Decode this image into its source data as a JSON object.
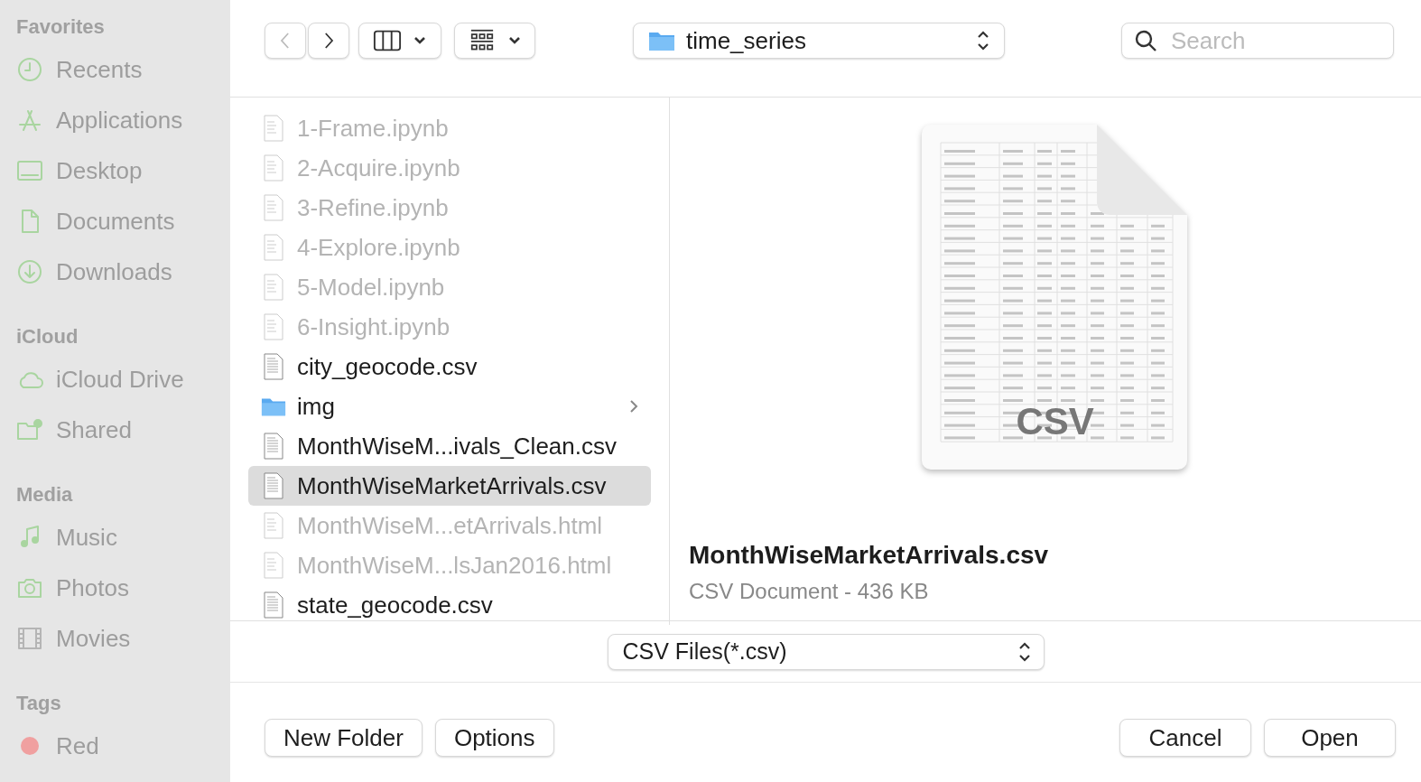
{
  "sidebar": {
    "sections": [
      {
        "title": "Favorites",
        "items": [
          {
            "label": "Recents",
            "kind": "clock",
            "disabled": true
          },
          {
            "label": "Applications",
            "kind": "apps",
            "disabled": true
          },
          {
            "label": "Desktop",
            "kind": "desktop",
            "disabled": true
          },
          {
            "label": "Documents",
            "kind": "document",
            "disabled": true
          },
          {
            "label": "Downloads",
            "kind": "download",
            "disabled": true
          }
        ]
      },
      {
        "title": "iCloud",
        "items": [
          {
            "label": "iCloud Drive",
            "kind": "cloud",
            "disabled": true
          },
          {
            "label": "Shared",
            "kind": "shared",
            "disabled": true
          }
        ]
      },
      {
        "title": "Media",
        "items": [
          {
            "label": "Music",
            "kind": "music",
            "disabled": true
          },
          {
            "label": "Photos",
            "kind": "camera",
            "disabled": true
          },
          {
            "label": "Movies",
            "kind": "film",
            "disabled": true
          }
        ]
      },
      {
        "title": "Tags",
        "items": [
          {
            "label": "Red",
            "kind": "tag",
            "color": "#f0a0a0",
            "disabled": true
          }
        ]
      }
    ]
  },
  "toolbar": {
    "back_disabled": true,
    "forward_disabled": false,
    "location": "time_series",
    "search": {
      "placeholder": "Search"
    }
  },
  "files": [
    {
      "name": "1-Frame.ipynb",
      "kind": "notebook",
      "disabled": true,
      "selected": false
    },
    {
      "name": "2-Acquire.ipynb",
      "kind": "notebook",
      "disabled": true,
      "selected": false
    },
    {
      "name": "3-Refine.ipynb",
      "kind": "notebook",
      "disabled": true,
      "selected": false
    },
    {
      "name": "4-Explore.ipynb",
      "kind": "notebook",
      "disabled": true,
      "selected": false
    },
    {
      "name": "5-Model.ipynb",
      "kind": "notebook",
      "disabled": true,
      "selected": false
    },
    {
      "name": "6-Insight.ipynb",
      "kind": "notebook",
      "disabled": true,
      "selected": false
    },
    {
      "name": "city_geocode.csv",
      "kind": "csv",
      "disabled": false,
      "selected": false
    },
    {
      "name": "img",
      "kind": "folder",
      "disabled": false,
      "selected": false
    },
    {
      "name": "MonthWiseM...ivals_Clean.csv",
      "kind": "csv",
      "disabled": false,
      "selected": false
    },
    {
      "name": "MonthWiseMarketArrivals.csv",
      "kind": "csv",
      "disabled": false,
      "selected": true
    },
    {
      "name": "MonthWiseM...etArrivals.html",
      "kind": "notebook",
      "disabled": true,
      "selected": false
    },
    {
      "name": "MonthWiseM...lsJan2016.html",
      "kind": "notebook",
      "disabled": true,
      "selected": false
    },
    {
      "name": "state_geocode.csv",
      "kind": "csv",
      "disabled": false,
      "selected": false
    }
  ],
  "preview": {
    "thumbnail": {
      "badge": "CSV"
    },
    "name": "MonthWiseMarketArrivals.csv",
    "info": "CSV Document - 436 KB"
  },
  "format": "CSV Files(*.csv)",
  "buttons": {
    "left": [
      "New Folder",
      "Options"
    ],
    "cancel": "Cancel",
    "confirm": "Open"
  }
}
